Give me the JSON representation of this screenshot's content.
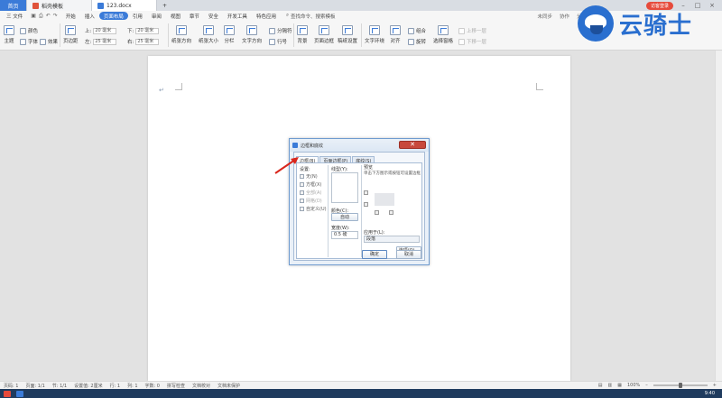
{
  "tabs": {
    "home": "首页",
    "templates": "稻壳模板",
    "document": "123.docx",
    "new_tab": "+",
    "login": "访客登录"
  },
  "menu": {
    "file": "三 文件",
    "items": [
      "开始",
      "插入",
      "页面布局",
      "引用",
      "审阅",
      "视图",
      "章节",
      "安全",
      "开发工具",
      "特色应用"
    ],
    "active": "页面布局",
    "search": "查找命令、搜索模板",
    "right_items": [
      "未同步",
      "协作",
      "分享"
    ]
  },
  "ribbon": {
    "theme": "主题",
    "color": "颜色",
    "font": "字体",
    "effect": "效果",
    "margins": "页边距",
    "top_label": "上:",
    "top_value": "20 毫米",
    "bottom_label": "下:",
    "bottom_value": "20 毫米",
    "left_label": "左:",
    "left_value": "25 毫米",
    "right_label": "右:",
    "right_value": "25 毫米",
    "orientation": "纸张方向",
    "size": "纸张大小",
    "columns": "分栏",
    "text_direction": "文字方向",
    "breaks": "分隔符",
    "line_numbers": "行号",
    "background": "背景",
    "page_borders": "页面边框",
    "draft_paper": "稿纸设置",
    "text_wrap": "文字环绕",
    "align": "对齐",
    "group": "组合",
    "rotate": "旋转",
    "selection_pane": "选择窗格",
    "bring_forward": "上移一层",
    "send_backward": "下移一层"
  },
  "logo": {
    "text": "云骑士"
  },
  "document": {
    "para_mark": "↵"
  },
  "dialog": {
    "title": "边框和底纹",
    "close": "✕",
    "tabs": [
      "边框(B)",
      "页面边框(P)",
      "底纹(S)"
    ],
    "settings_label": "设置:",
    "settings_options": [
      "无(N)",
      "方框(X)",
      "全部(A)",
      "网格(D)",
      "自定义(U)"
    ],
    "style_label": "线型(Y):",
    "color_label": "颜色(C):",
    "color_value": "自动",
    "width_label": "宽度(W):",
    "width_value": "0.5  磅",
    "preview_label": "预览",
    "preview_hint": "单击下方图示或按钮可设置边框",
    "apply_label": "应用于(L):",
    "apply_value": "段落",
    "options_button": "选项(O)...",
    "ok": "确定",
    "cancel": "取消"
  },
  "status": {
    "page": "页码: 1",
    "pages": "页面: 1/1",
    "section": "节: 1/1",
    "settings": "设置值: 2厘米",
    "row": "行: 1",
    "col": "列: 1",
    "words": "字数: 0",
    "spell": "拼写检查",
    "doc_check": "文档校对",
    "protect": "文档未保护",
    "zoom": "100%"
  },
  "taskbar": {
    "time": "9:40"
  }
}
